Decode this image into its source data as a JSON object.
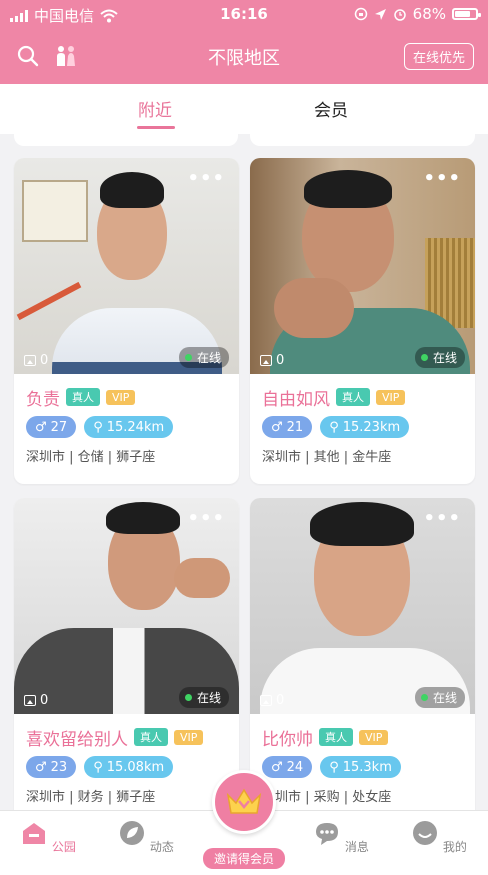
{
  "status_bar": {
    "carrier": "中国电信",
    "time": "16:16",
    "battery": "68%"
  },
  "header": {
    "title": "不限地区",
    "online_first": "在线优先"
  },
  "tabs": [
    {
      "label": "附近"
    },
    {
      "label": "会员"
    }
  ],
  "cards": [
    {
      "name": "负责",
      "real": "真人",
      "vip": "VIP",
      "age": "27",
      "distance": "15.24km",
      "location": "深圳市 | 仓储 | 狮子座",
      "photos": "0",
      "online": "在线"
    },
    {
      "name": "自由如风",
      "real": "真人",
      "vip": "VIP",
      "age": "21",
      "distance": "15.23km",
      "location": "深圳市 | 其他 | 金牛座",
      "photos": "0",
      "online": "在线"
    },
    {
      "name": "喜欢留给别人",
      "real": "真人",
      "vip": "VIP",
      "age": "23",
      "distance": "15.08km",
      "location": "深圳市 | 财务 | 狮子座",
      "photos": "0",
      "online": "在线"
    },
    {
      "name": "比你帅",
      "real": "真人",
      "vip": "VIP",
      "age": "24",
      "distance": "15.3km",
      "location": "深圳市 | 采购 | 处女座",
      "photos": "0",
      "online": "在线"
    }
  ],
  "bottom_nav": [
    {
      "label": "公园"
    },
    {
      "label": "动态"
    },
    {
      "label": "邀请得会员"
    },
    {
      "label": "消息"
    },
    {
      "label": "我的"
    }
  ],
  "colors": {
    "accent": "#ef86a6",
    "real_badge": "#49c9b0",
    "vip_badge": "#f6c25b",
    "online_dot": "#3fd463"
  }
}
